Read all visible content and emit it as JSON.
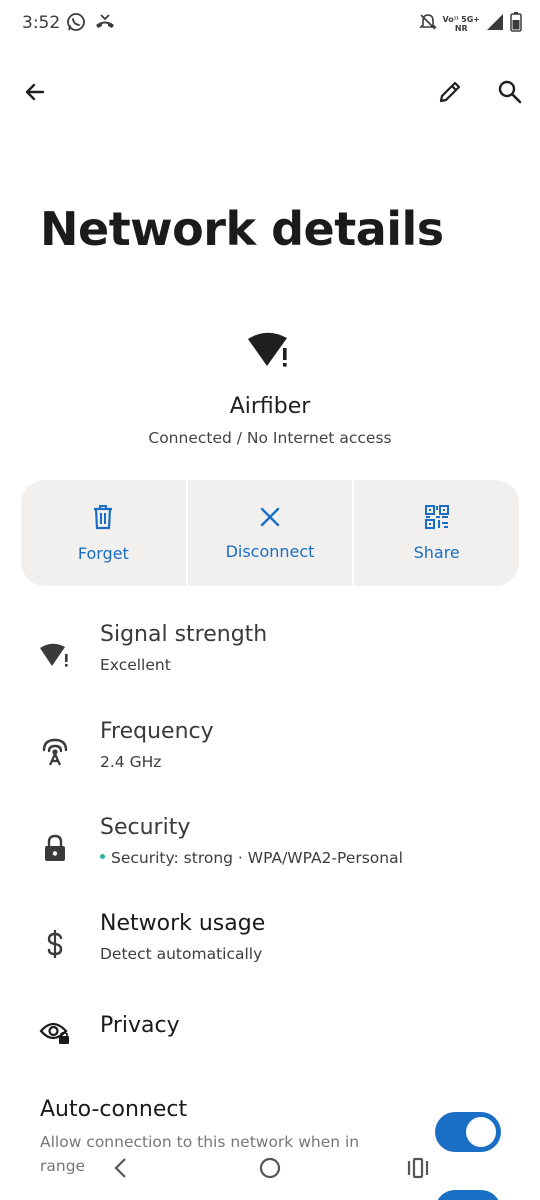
{
  "status_bar": {
    "time": "3:52",
    "network_top": "Vo⁾⁾ 5G+",
    "network_bottom": "NR"
  },
  "top_bar": {
    "back_icon": "arrow-left-icon",
    "edit_icon": "pencil-icon",
    "search_icon": "search-icon"
  },
  "page": {
    "title": "Network details"
  },
  "network": {
    "name": "Airfiber",
    "status": "Connected / No Internet access"
  },
  "actions": [
    {
      "label": "Forget",
      "icon": "trash-icon"
    },
    {
      "label": "Disconnect",
      "icon": "close-icon"
    },
    {
      "label": "Share",
      "icon": "qr-code-icon"
    }
  ],
  "details": {
    "signal": {
      "title": "Signal strength",
      "value": "Excellent",
      "icon": "wifi-alert-icon"
    },
    "frequency": {
      "title": "Frequency",
      "value": "2.4 GHz",
      "icon": "antenna-icon"
    },
    "security": {
      "title": "Security",
      "value": "Security: strong · WPA/WPA2-Personal",
      "icon": "lock-icon"
    },
    "usage": {
      "title": "Network usage",
      "value": "Detect automatically",
      "icon": "dollar-icon"
    },
    "privacy": {
      "title": "Privacy",
      "icon": "eye-lock-icon"
    }
  },
  "auto_connect": {
    "title": "Auto-connect",
    "description": "Allow connection to this network when in range",
    "enabled": true
  },
  "colors": {
    "accent": "#1a6fc4",
    "panel": "#f1f0ef",
    "security_dot": "#2bb3a0"
  }
}
